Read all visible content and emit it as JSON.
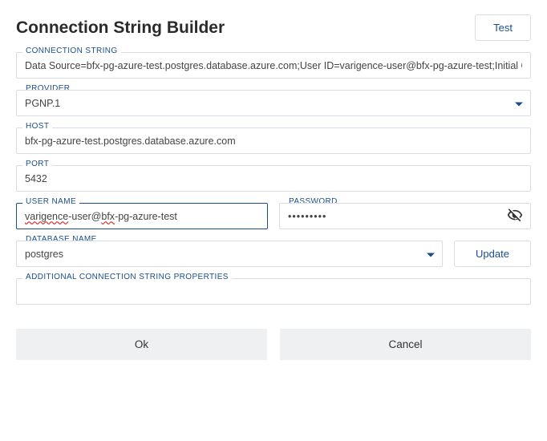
{
  "header": {
    "title": "Connection String Builder",
    "test_label": "Test"
  },
  "connection_string": {
    "label": "CONNECTION STRING",
    "value": "Data Source=bfx-pg-azure-test.postgres.database.azure.com;User ID=varigence-user@bfx-pg-azure-test;Initial Catalog="
  },
  "provider": {
    "label": "PROVIDER",
    "value": "PGNP.1"
  },
  "host": {
    "label": "HOST",
    "value": "bfx-pg-azure-test.postgres.database.azure.com"
  },
  "port": {
    "label": "PORT",
    "value": "5432"
  },
  "user_name": {
    "label": "USER NAME",
    "value": "varigence-user@bfx-pg-azure-test",
    "spell_prefix": "varigence",
    "middle": "-user@",
    "spell_suffix": "bfx",
    "tail": "-pg-azure-test"
  },
  "password": {
    "label": "PASSWORD",
    "masked": "•••••••••"
  },
  "database_name": {
    "label": "DATABASE NAME",
    "value": "postgres",
    "update_label": "Update"
  },
  "additional": {
    "label": "ADDITIONAL CONNECTION STRING PROPERTIES",
    "value": ""
  },
  "footer": {
    "ok": "Ok",
    "cancel": "Cancel"
  }
}
